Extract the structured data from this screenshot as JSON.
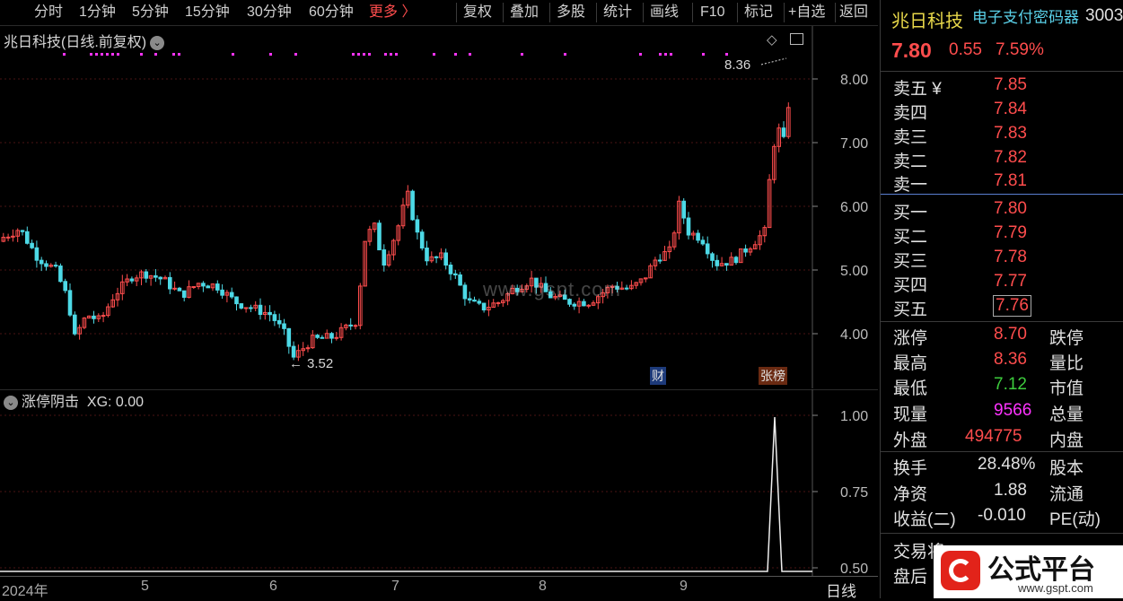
{
  "toolbar": {
    "periods": [
      "分时",
      "1分钟",
      "5分钟",
      "15分钟",
      "30分钟",
      "60分钟"
    ],
    "more": "更多 〉",
    "actions": [
      "复权",
      "叠加",
      "多股",
      "统计",
      "画线",
      "F10",
      "标记",
      "+自选",
      "返回"
    ]
  },
  "chart": {
    "title": "兆日科技(日线.前复权)",
    "high_label": "8.36",
    "low_label": "3.52",
    "y_ticks": [
      "8.00",
      "7.00",
      "6.00",
      "5.00",
      "4.00"
    ],
    "tag_cai": "财",
    "tag_zhangbang": "张榜",
    "watermark": "www.gspt.com"
  },
  "indicator": {
    "title": "涨停阴击",
    "xg_label": "XG: 0.00",
    "y_ticks": [
      "1.00",
      "0.75",
      "0.50"
    ]
  },
  "x_axis": {
    "labels": [
      "2024年",
      "5",
      "6",
      "7",
      "8",
      "9"
    ],
    "period_label": "日线"
  },
  "quote": {
    "name": "兆日科技",
    "concept": "电子支付密码器",
    "code_partial": "3003",
    "price": "7.80",
    "change": "0.55",
    "change_pct": "7.59%",
    "asks": [
      {
        "label": "卖五 ¥",
        "price": "7.85"
      },
      {
        "label": "卖四",
        "price": "7.84"
      },
      {
        "label": "卖三",
        "price": "7.83"
      },
      {
        "label": "卖二",
        "price": "7.82"
      },
      {
        "label": "卖一",
        "price": "7.81"
      }
    ],
    "bids": [
      {
        "label": "买一",
        "price": "7.80"
      },
      {
        "label": "买二",
        "price": "7.79"
      },
      {
        "label": "买三",
        "price": "7.78"
      },
      {
        "label": "买四",
        "price": "7.77"
      },
      {
        "label": "买五",
        "price": "7.76"
      }
    ],
    "stats": [
      {
        "label": "涨停",
        "value": "8.70",
        "label2": "跌停"
      },
      {
        "label": "最高",
        "value": "8.36",
        "label2": "量比"
      },
      {
        "label": "最低",
        "value": "7.12",
        "label2": "市值"
      },
      {
        "label": "现量",
        "value": "9566",
        "label2": "总量"
      },
      {
        "label": "外盘",
        "value": "494775",
        "label2": "内盘"
      }
    ],
    "stats2": [
      {
        "label": "换手",
        "value": "28.48%",
        "label2": "股本"
      },
      {
        "label": "净资",
        "value": "1.88",
        "label2": "流通"
      },
      {
        "label": "收益(二)",
        "value": "-0.010",
        "label2": "PE(动)"
      }
    ],
    "bottom_rows": [
      "交易将",
      "盘后"
    ]
  },
  "logo": {
    "text": "公式平台",
    "url": "www.gspt.com"
  },
  "colors": {
    "up": "#ff4d4d",
    "down": "#4dd9e6",
    "signal": "#ff33ff",
    "grid": "#3a1010"
  },
  "chart_data": {
    "type": "candlestick",
    "dates": [
      "2024-04",
      "2024-05",
      "2024-06",
      "2024-07",
      "2024-08",
      "2024-09"
    ],
    "high": 8.36,
    "low": 3.52,
    "last_close": 7.8,
    "ylim": [
      3.3,
      8.5
    ]
  }
}
